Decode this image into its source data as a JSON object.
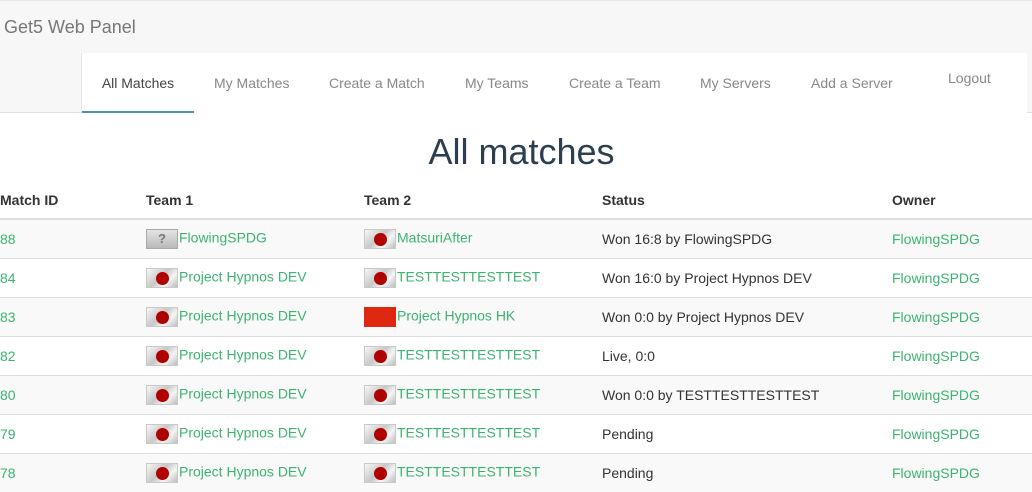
{
  "brand": "Get5 Web Panel",
  "nav": {
    "all_matches": "All Matches",
    "my_matches": "My Matches",
    "create_match": "Create a Match",
    "my_teams": "My Teams",
    "create_team": "Create a Team",
    "my_servers": "My Servers",
    "add_server": "Add a Server",
    "logout": "Logout"
  },
  "page_title": "All matches",
  "table": {
    "headers": {
      "match_id": "Match ID",
      "team1": "Team 1",
      "team2": "Team 2",
      "status": "Status",
      "owner": "Owner"
    },
    "rows": [
      {
        "id": "88",
        "team1": "FlowingSPDG",
        "team1_flag": "unknown",
        "team2": "MatsuriAfter",
        "team2_flag": "jp",
        "status": "Won 16:8 by FlowingSPDG",
        "owner": "FlowingSPDG"
      },
      {
        "id": "84",
        "team1": "Project Hypnos DEV",
        "team1_flag": "jp",
        "team2": "TESTTESTTESTTEST",
        "team2_flag": "jp",
        "status": "Won 16:0 by Project Hypnos DEV",
        "owner": "FlowingSPDG"
      },
      {
        "id": "83",
        "team1": "Project Hypnos DEV",
        "team1_flag": "jp",
        "team2": "Project Hypnos HK",
        "team2_flag": "hk",
        "status": "Won 0:0 by Project Hypnos DEV",
        "owner": "FlowingSPDG"
      },
      {
        "id": "82",
        "team1": "Project Hypnos DEV",
        "team1_flag": "jp",
        "team2": "TESTTESTTESTTEST",
        "team2_flag": "jp",
        "status": "Live, 0:0",
        "owner": "FlowingSPDG"
      },
      {
        "id": "80",
        "team1": "Project Hypnos DEV",
        "team1_flag": "jp",
        "team2": "TESTTESTTESTTEST",
        "team2_flag": "jp",
        "status": "Won 0:0 by TESTTESTTESTTEST",
        "owner": "FlowingSPDG"
      },
      {
        "id": "79",
        "team1": "Project Hypnos DEV",
        "team1_flag": "jp",
        "team2": "TESTTESTTESTTEST",
        "team2_flag": "jp",
        "status": "Pending",
        "owner": "FlowingSPDG"
      },
      {
        "id": "78",
        "team1": "Project Hypnos DEV",
        "team1_flag": "jp",
        "team2": "TESTTESTTESTTEST",
        "team2_flag": "jp",
        "status": "Pending",
        "owner": "FlowingSPDG"
      }
    ]
  },
  "colors": {
    "link": "#3cb371",
    "active_tab_border": "#4a90c2",
    "title": "#2c3e50"
  }
}
